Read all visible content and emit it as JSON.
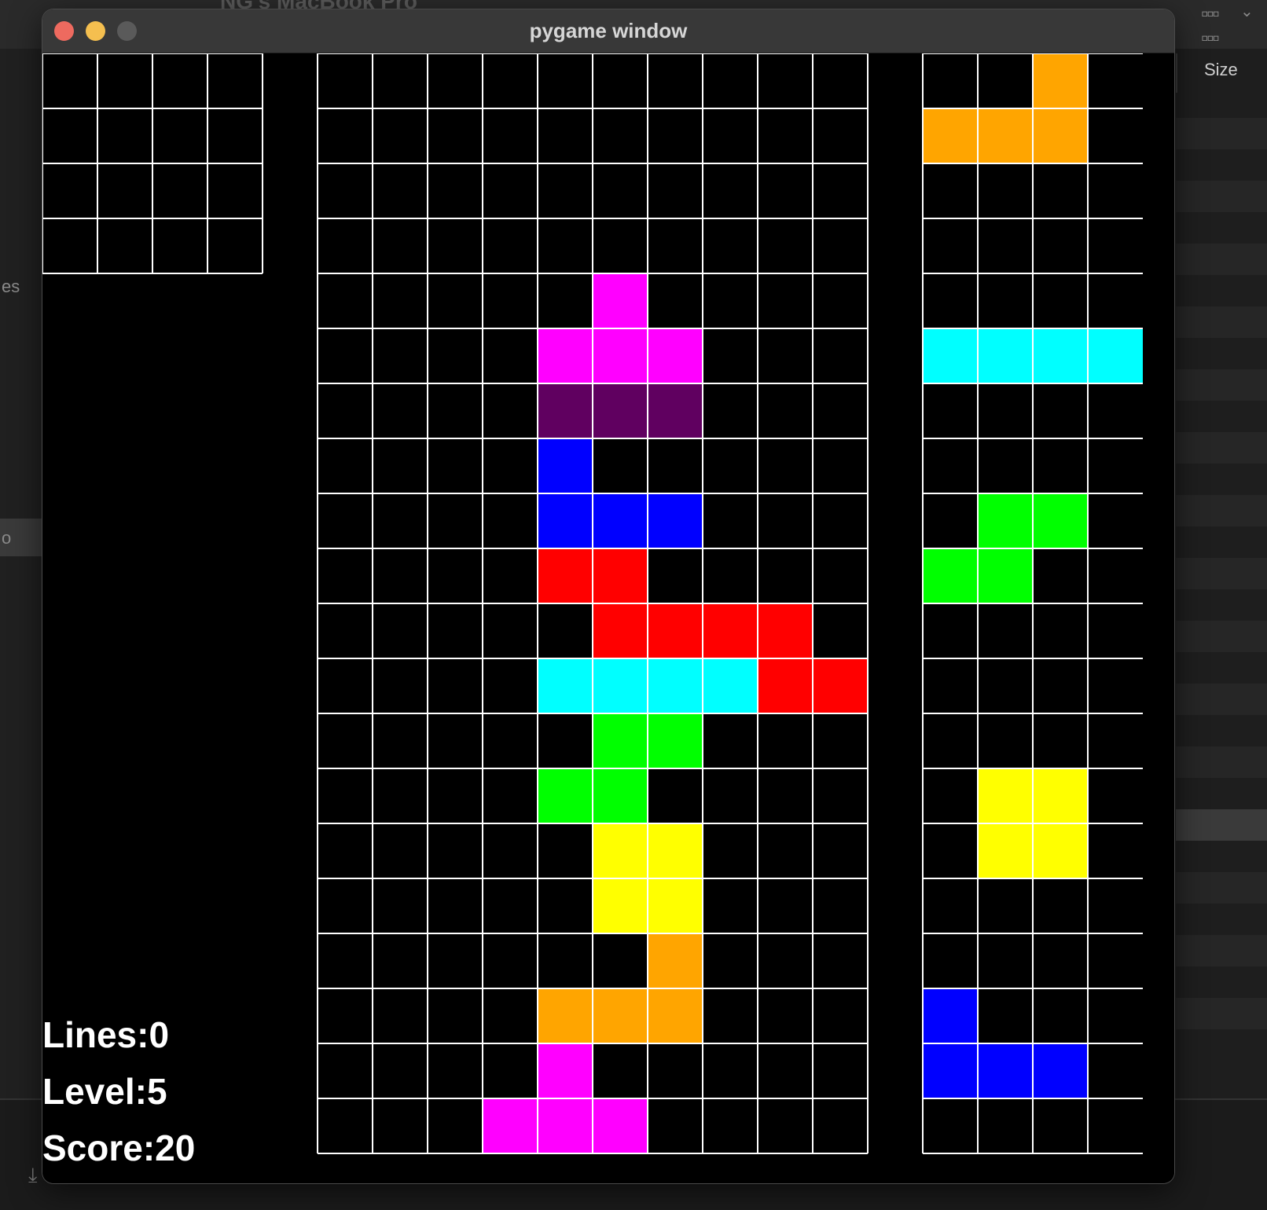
{
  "window": {
    "title": "pygame window"
  },
  "background": {
    "faded_title": "NG's MacBook Pro",
    "size_header": "Size",
    "left_texts": [
      "es",
      "o"
    ]
  },
  "stats": {
    "lines": "Lines:0",
    "level": "Level:5",
    "score": "Score:20"
  },
  "colors": {
    "grid_line": "#ffffff",
    "background": "#000000",
    "M": "#ff00ff",
    "P": "#600060",
    "B": "#0000ff",
    "R": "#ff0000",
    "C": "#00ffff",
    "G": "#00ff00",
    "Y": "#ffff00",
    "O": "#ffa500"
  },
  "hold_box": {
    "cols": 4,
    "rows": 4,
    "cells": [
      "....",
      "....",
      "....",
      "...."
    ]
  },
  "board": {
    "cols": 10,
    "rows": 20,
    "cells": [
      "..........",
      "..........",
      "..........",
      "..........",
      ".....M....",
      "....MMM...",
      "....PPP...",
      "....B.....",
      "....BBB...",
      "....RR....",
      ".....RRRR.",
      "....CCCCRR",
      ".....GG...",
      "....GG....",
      ".....YY...",
      ".....YY...",
      "......O...",
      "....OOO...",
      "....M.....",
      "...MMM...."
    ]
  },
  "next_queue": {
    "cols": 4,
    "rows": 20,
    "cells": [
      "..O.",
      "OOO.",
      "....",
      "....",
      "....",
      "CCCC",
      "....",
      "....",
      ".GG.",
      "GG..",
      "....",
      "....",
      "....",
      ".YY.",
      ".YY.",
      "....",
      "....",
      "B...",
      "BBB.",
      "...."
    ]
  }
}
